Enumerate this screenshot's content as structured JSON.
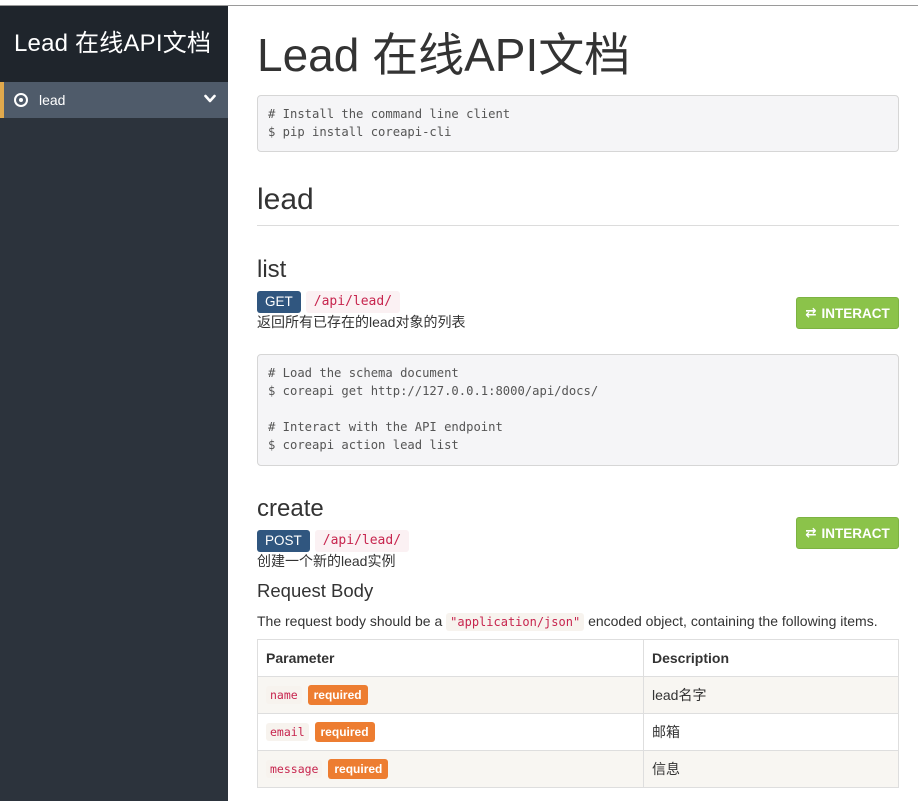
{
  "sidebar": {
    "brand": "Lead 在线API文档",
    "items": [
      {
        "label": "lead",
        "icon": "radio-dot-icon",
        "expand_icon": "chevron-down-icon"
      }
    ]
  },
  "page": {
    "title": "Lead 在线API文档",
    "install_code": "# Install the command line client\n$ pip install coreapi-cli"
  },
  "section": {
    "title": "lead",
    "endpoints": [
      {
        "name": "list",
        "method": "GET",
        "path": "/api/lead/",
        "description": "返回所有已存在的lead对象的列表",
        "interact_label": "INTERACT",
        "code": "# Load the schema document\n$ coreapi get http://127.0.0.1:8000/api/docs/\n\n# Interact with the API endpoint\n$ coreapi action lead list"
      },
      {
        "name": "create",
        "method": "POST",
        "path": "/api/lead/",
        "description": "创建一个新的lead实例",
        "interact_label": "INTERACT",
        "request_body": {
          "title": "Request Body",
          "text_before": "The request body should be a",
          "content_type": "\"application/json\"",
          "text_after": "encoded object, containing the following items.",
          "columns": [
            "Parameter",
            "Description"
          ],
          "rows": [
            {
              "param": "name",
              "badge": "required",
              "desc": "lead名字"
            },
            {
              "param": "email",
              "badge": "required",
              "desc": "邮箱"
            },
            {
              "param": "message",
              "badge": "required",
              "desc": "信息"
            }
          ]
        }
      }
    ]
  },
  "colors": {
    "sidebar_bg": "#2c333c",
    "brand_bg": "#1f252c",
    "active_item_bg": "#4f5b6a",
    "active_marker": "#e0a94d",
    "method_badge": "#30567f",
    "interact_button": "#8bc34a",
    "required_badge": "#ed7d31",
    "code_text": "#c7254e"
  }
}
